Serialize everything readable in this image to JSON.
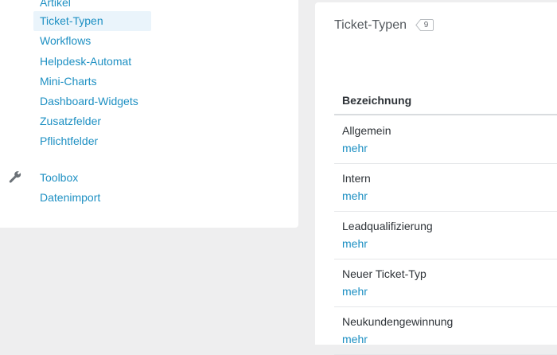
{
  "sidebar": {
    "items": [
      {
        "label": "Artikel"
      },
      {
        "label": "Ticket-Typen"
      },
      {
        "label": "Workflows"
      },
      {
        "label": "Helpdesk-Automat"
      },
      {
        "label": "Mini-Charts"
      },
      {
        "label": "Dashboard-Widgets"
      },
      {
        "label": "Zusatzfelder"
      },
      {
        "label": "Pflichtfelder"
      }
    ],
    "toolbox": {
      "icon": "wrench-icon",
      "items": [
        {
          "label": "Toolbox"
        },
        {
          "label": "Datenimport"
        }
      ]
    }
  },
  "panel": {
    "title": "Ticket-Typen",
    "count": "9",
    "table": {
      "header": "Bezeichnung",
      "rows": [
        {
          "name": "Allgemein",
          "more": "mehr"
        },
        {
          "name": "Intern",
          "more": "mehr"
        },
        {
          "name": "Leadqualifizierung",
          "more": "mehr"
        },
        {
          "name": "Neuer Ticket-Typ",
          "more": "mehr"
        },
        {
          "name": "Neukundengewinnung",
          "more": "mehr"
        }
      ]
    }
  },
  "colors": {
    "link": "#1e90c3",
    "active_bg": "#eaf4fb",
    "background": "#eeeeef"
  }
}
